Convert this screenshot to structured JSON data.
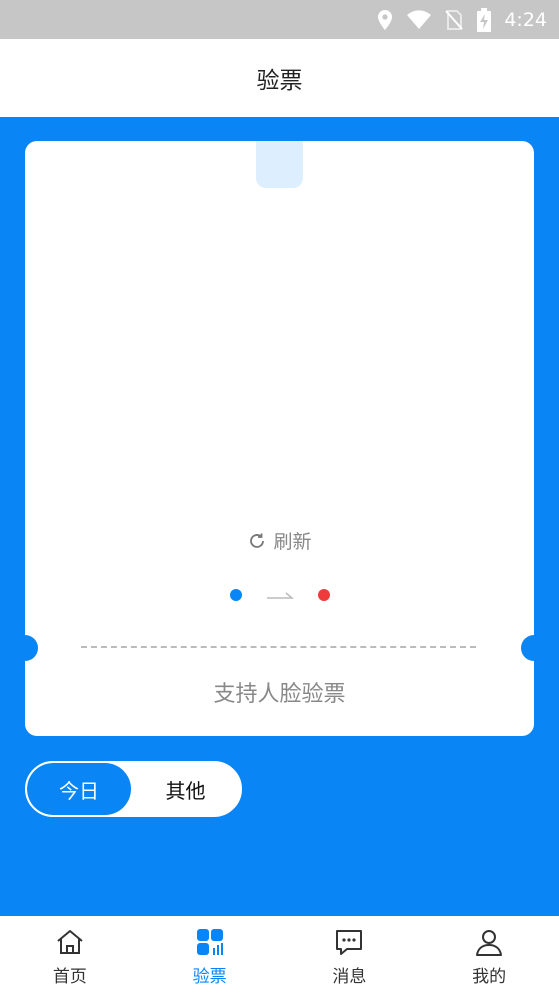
{
  "status": {
    "time": "4:24",
    "icons": [
      "location-icon",
      "wifi-icon",
      "no-sim-icon",
      "battery-charging-icon"
    ]
  },
  "header": {
    "title": "验票"
  },
  "ticket": {
    "refresh_label": "刷新",
    "support_text": "支持人脸验票",
    "flow": {
      "from_color": "#0a85f5",
      "to_color": "#ee3b3b"
    }
  },
  "day_toggle": {
    "options": [
      "今日",
      "其他"
    ],
    "selected": "今日"
  },
  "tabbar": {
    "items": [
      {
        "label": "首页",
        "icon": "home-icon",
        "active": false
      },
      {
        "label": "验票",
        "icon": "ticket-grid-icon",
        "active": true
      },
      {
        "label": "消息",
        "icon": "message-icon",
        "active": false
      },
      {
        "label": "我的",
        "icon": "profile-icon",
        "active": false
      }
    ]
  },
  "colors": {
    "primary": "#0a85f5",
    "status_bar": "#c6c6c6",
    "accent_red": "#ee3b3b"
  }
}
